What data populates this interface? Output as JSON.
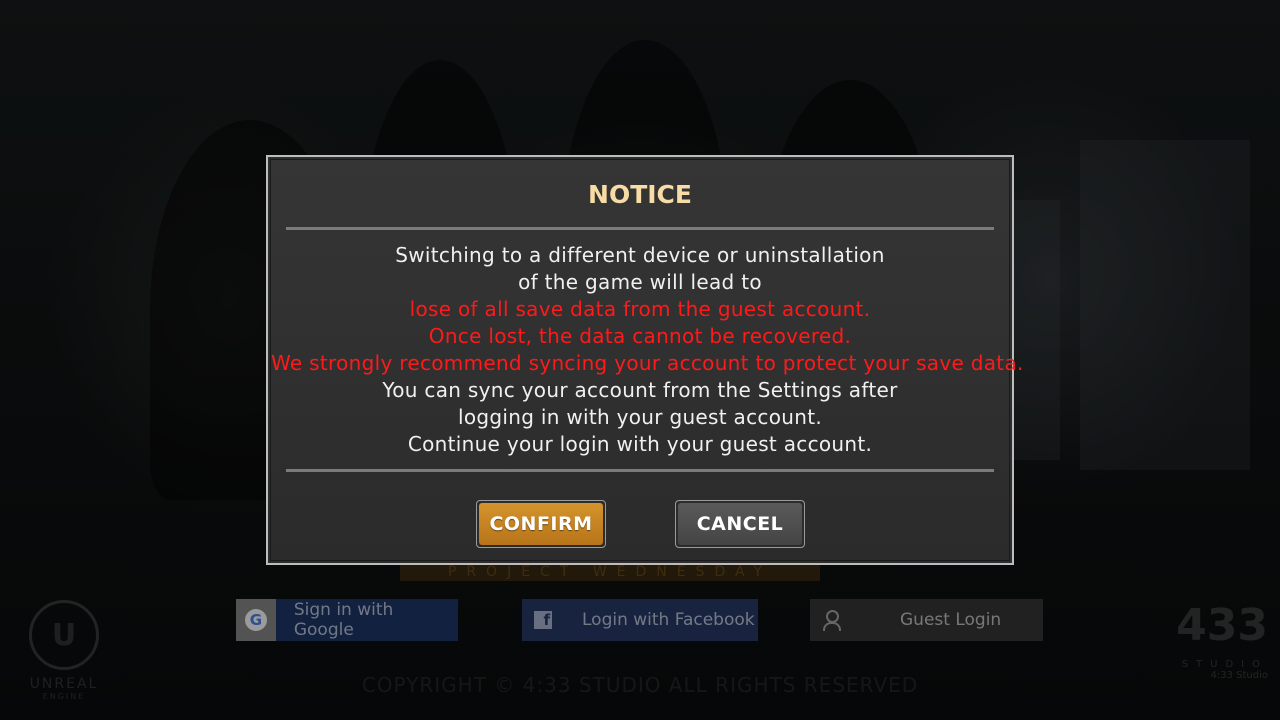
{
  "notice": {
    "title": "NOTICE",
    "lines": [
      {
        "text": "Switching to a different device or uninstallation",
        "color": "white"
      },
      {
        "text": "of the game will lead to",
        "color": "white"
      },
      {
        "text": "lose of all save data from the guest account.",
        "color": "red"
      },
      {
        "text": "Once lost, the data cannot be recovered.",
        "color": "red"
      },
      {
        "text": "We strongly recommend syncing your account to protect your save data.",
        "color": "red"
      },
      {
        "text": "You can sync your account from the Settings after",
        "color": "white"
      },
      {
        "text": "logging in with your guest account.",
        "color": "white"
      },
      {
        "text": "Continue your login with your guest account.",
        "color": "white"
      }
    ],
    "confirm_label": "CONFIRM",
    "cancel_label": "CANCEL"
  },
  "login": {
    "google_label": "Sign in with Google",
    "google_icon": "G",
    "facebook_label": "Login with Facebook",
    "facebook_icon": "f",
    "guest_label": "Guest Login"
  },
  "background": {
    "copyright": "COPYRIGHT © 4:33 STUDIO ALL RIGHTS RESERVED",
    "subtitle": "PROJECT WEDNESDAY",
    "engine_logo_line1": "UNREAL",
    "engine_logo_line2": "ENGINE",
    "studio_logo": "433",
    "studio_word": "STUDIO",
    "studio_sub": "4:33 Studio"
  },
  "colors": {
    "title": "#f7dca6",
    "warning": "#ff1a1a",
    "confirm": "#c7841f",
    "cancel": "#4e4e4e"
  }
}
